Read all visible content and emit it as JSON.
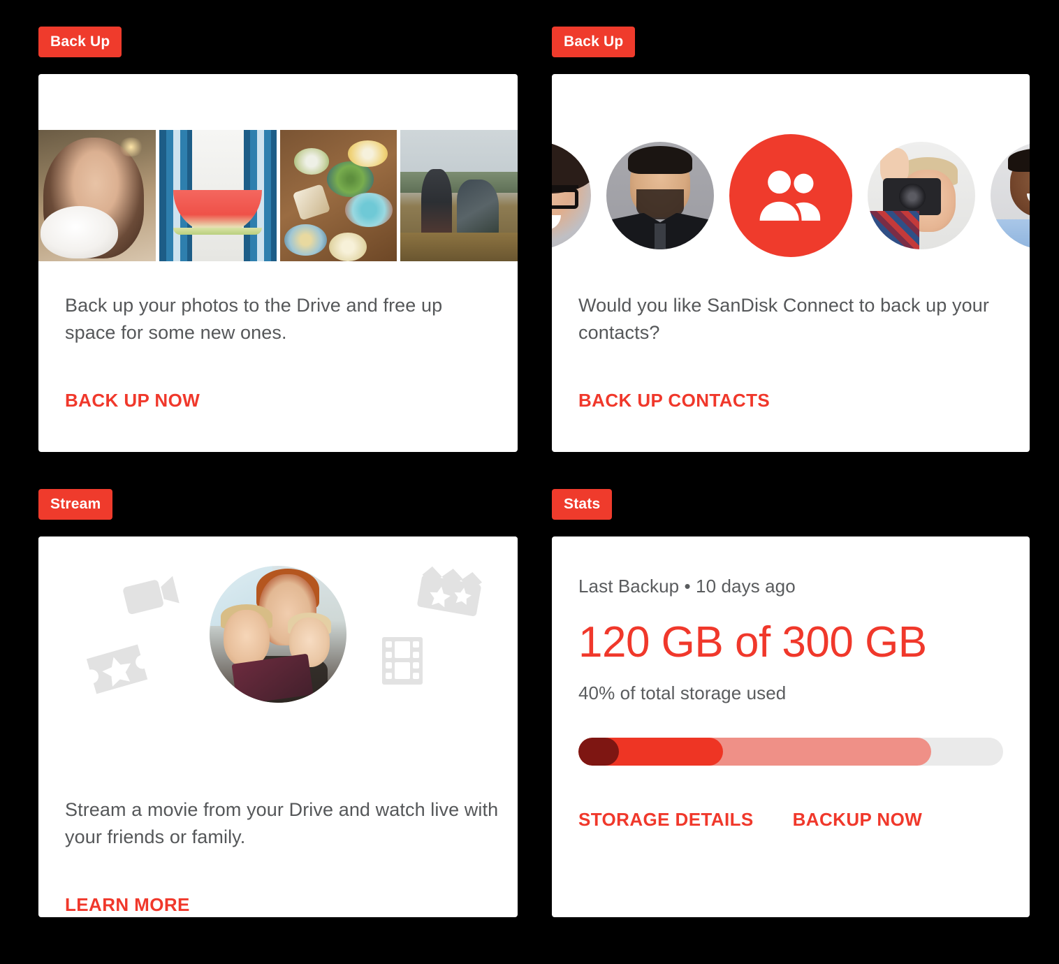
{
  "theme": {
    "background": "#000000",
    "card_background": "#FFFFFF",
    "accent_red": "#EF3B2C",
    "link_red": "#F0382B",
    "body_text": "#555759",
    "track_gray": "#EAEAEA"
  },
  "cards": {
    "backup_photos": {
      "tag": "Back Up",
      "body": "Back up your photos to the Drive and free up space for some new ones.",
      "action": "BACK UP NOW",
      "photos": [
        "woman-drinking-coffee-photo",
        "person-holding-watermelon-photo",
        "overhead-food-table-photo",
        "couple-outdoors-photo"
      ]
    },
    "backup_contacts": {
      "tag": "Back Up",
      "body": "Would you like SanDisk Connect to back up your contacts?",
      "action": "BACK UP CONTACTS",
      "avatars": [
        "woman-with-glasses-avatar",
        "man-in-suit-avatar",
        "contacts-group-icon",
        "woman-with-camera-avatar",
        "man-in-blue-shirt-avatar"
      ]
    },
    "stream": {
      "tag": "Stream",
      "body": "Stream a movie from your Drive and watch live with your friends or family.",
      "action": "LEARN MORE",
      "illustration": "mother-and-children-watching-tablet-photo",
      "decorations": [
        "video-camera-icon",
        "ticket-star-icon",
        "clapperboard-icon",
        "film-strip-icon"
      ]
    },
    "stats": {
      "tag": "Stats",
      "last_backup": "Last Backup • 10 days ago",
      "storage_headline": "120 GB of 300 GB",
      "storage_percent_label": "40% of total storage used",
      "storage_used_gb": 120,
      "storage_total_gb": 300,
      "storage_percent": 40,
      "bar": {
        "segments": [
          {
            "name": "dark-segment",
            "color": "#7E1612",
            "width_pct": 9
          },
          {
            "name": "red-segment",
            "color": "#EE3524",
            "width_pct": 25
          },
          {
            "name": "salmon-segment",
            "color": "#EF9087",
            "width_pct": 49
          }
        ],
        "track_color": "#EAEAEA"
      },
      "actions": {
        "storage_details": "STORAGE DETAILS",
        "backup_now": "BACKUP NOW"
      }
    }
  }
}
